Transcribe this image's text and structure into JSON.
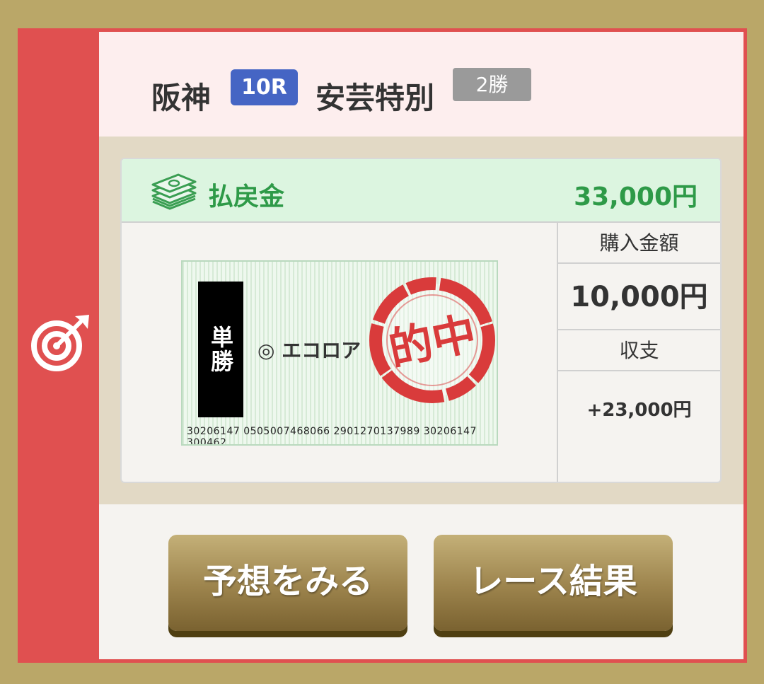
{
  "header": {
    "venue": "阪神",
    "race_number": "10R",
    "race_name": "安芸特別",
    "race_class": "2勝"
  },
  "payout": {
    "label": "払戻金",
    "value": "33,000円"
  },
  "ticket": {
    "bet_type": "単勝",
    "selection": "◎ エコロア",
    "serial": "30206147    0505007468066 2901270137989 30206147 300462",
    "stamp": "的中"
  },
  "summary": {
    "purchase_label": "購入金額",
    "purchase_value": "10,000円",
    "balance_label": "収支",
    "balance_value": "+23,000円"
  },
  "buttons": {
    "predict": "予想をみる",
    "result": "レース結果"
  },
  "colors": {
    "frame": "#baa768",
    "accent_red": "#e05050",
    "race_badge": "#4565c4",
    "payout_green": "#2e9a48"
  },
  "icons": [
    "target-icon",
    "money-stack-icon",
    "hit-stamp"
  ]
}
